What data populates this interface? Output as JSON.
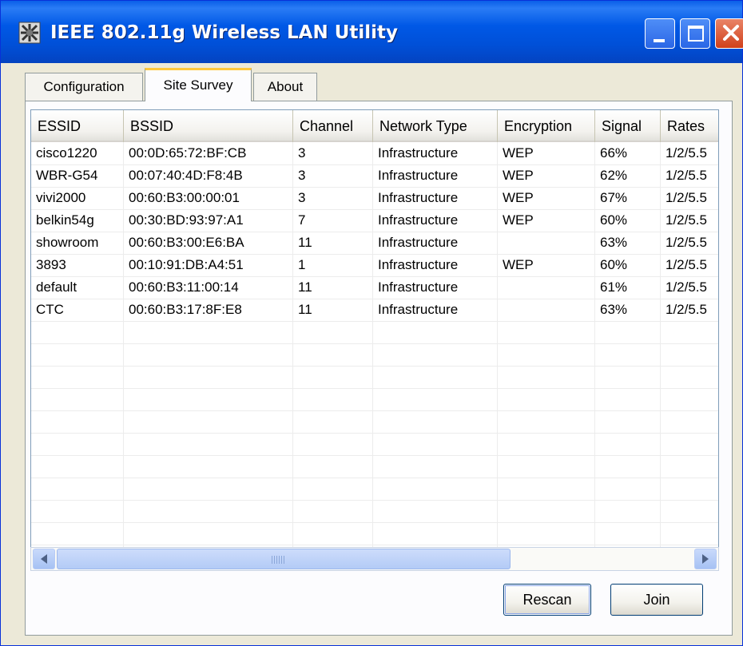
{
  "window": {
    "title": "IEEE 802.11g Wireless LAN Utility",
    "icon": "wireless-card-icon"
  },
  "tabs": [
    {
      "label": "Configuration",
      "selected": false
    },
    {
      "label": "Site Survey",
      "selected": true
    },
    {
      "label": "About",
      "selected": false
    }
  ],
  "table": {
    "columns": [
      "ESSID",
      "BSSID",
      "Channel",
      "Network Type",
      "Encryption",
      "Signal",
      "Rates"
    ],
    "rows": [
      [
        "cisco1220",
        "00:0D:65:72:BF:CB",
        "3",
        "Infrastructure",
        "WEP",
        "66%",
        "1/2/5.5"
      ],
      [
        "WBR-G54",
        "00:07:40:4D:F8:4B",
        "3",
        "Infrastructure",
        "WEP",
        "62%",
        "1/2/5.5"
      ],
      [
        "vivi2000",
        "00:60:B3:00:00:01",
        "3",
        "Infrastructure",
        "WEP",
        "67%",
        "1/2/5.5"
      ],
      [
        "belkin54g",
        "00:30:BD:93:97:A1",
        "7",
        "Infrastructure",
        "WEP",
        "60%",
        "1/2/5.5"
      ],
      [
        "showroom",
        "00:60:B3:00:E6:BA",
        "11",
        "Infrastructure",
        "",
        "63%",
        "1/2/5.5"
      ],
      [
        "3893",
        "00:10:91:DB:A4:51",
        "1",
        "Infrastructure",
        "WEP",
        "60%",
        "1/2/5.5"
      ],
      [
        "default",
        "00:60:B3:11:00:14",
        "11",
        "Infrastructure",
        "",
        "61%",
        "1/2/5.5"
      ],
      [
        "CTC",
        "00:60:B3:17:8F:E8",
        "11",
        "Infrastructure",
        "",
        "63%",
        "1/2/5.5"
      ]
    ]
  },
  "buttons": {
    "rescan": "Rescan",
    "join": "Join"
  },
  "colors": {
    "titlebar": "#0058e6",
    "tab_highlight": "#ffc83c",
    "close_button": "#d0401b"
  }
}
